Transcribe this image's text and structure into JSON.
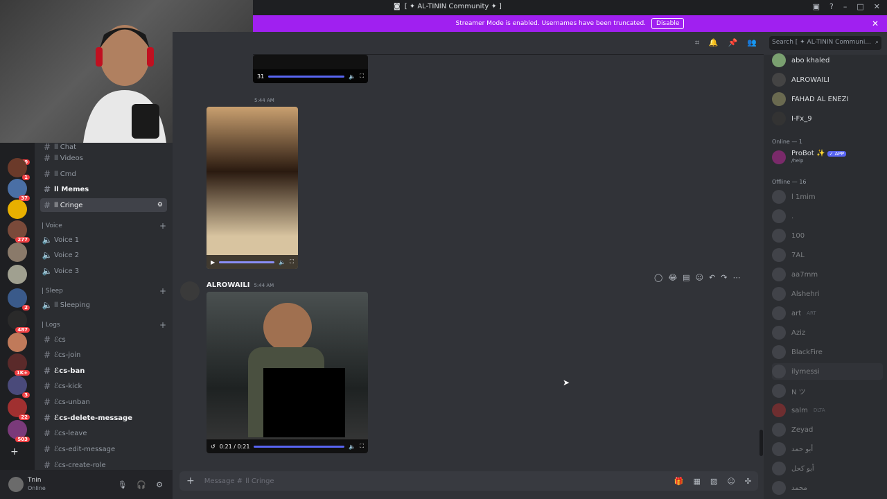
{
  "window": {
    "title": "[ ✦ AL-TININ Community ✦ ]"
  },
  "streamer_banner": {
    "text": "Streamer Mode is enabled. Usernames have been truncated.",
    "button": "Disable"
  },
  "search": {
    "placeholder": "Search [ ✦ AL-TININ Communi..."
  },
  "guild_badges": [
    "60",
    "1",
    "37",
    "277",
    "2",
    "487",
    "1K+",
    "3",
    "22",
    "503"
  ],
  "channels": {
    "items": [
      {
        "label": "ll Chat"
      },
      {
        "label": "ll Videos"
      },
      {
        "label": "ll Cmd"
      },
      {
        "label": "ll Memes"
      },
      {
        "label": "ll Cringe"
      }
    ],
    "voice_category": "| Voice",
    "voice": [
      "Voice 1",
      "Voice 2",
      "Voice 3"
    ],
    "sleep_category": "| Sleep",
    "sleep": [
      "ll Sleeping"
    ],
    "logs_category": "| Logs",
    "logs": [
      "ℰcs",
      "ℰcs-join",
      "ℰcs-ban",
      "ℰcs-kick",
      "ℰcs-unban",
      "ℰcs-delete-message",
      "ℰcs-leave",
      "ℰcs-edit-message",
      "ℰcs-create-role"
    ]
  },
  "user": {
    "name": "Tnin",
    "status": "Online"
  },
  "messages": {
    "top_video_time": "31",
    "second_time": "5:44 AM",
    "author": "ALROWAILI",
    "author_time": "5:44 AM",
    "video_time": "0:21 / 0:21"
  },
  "composer": {
    "placeholder": "Message #",
    "channel": "ll Cringe"
  },
  "members": {
    "online_top": [
      "abo khaled",
      "ALROWAILI",
      "FAHAD AL ENEZI",
      "I-Fx_9"
    ],
    "online_header": "Online — 1",
    "bot": {
      "name": "ProBot ✨",
      "tag": "✓ APP",
      "sub": "/help"
    },
    "offline_header": "Offline — 16",
    "offline": [
      "l 1mim",
      ".",
      "100",
      "7AL",
      "aa7mm",
      "Alshehri",
      "art",
      "Aziz",
      "BlackFire",
      "ilymessi",
      "N ツ",
      "salm",
      "Zeyad",
      "أبو حمد",
      "أبو كحل",
      "محمد"
    ],
    "offline_tags": {
      "art": "ART",
      "salm": "DLTA"
    }
  }
}
